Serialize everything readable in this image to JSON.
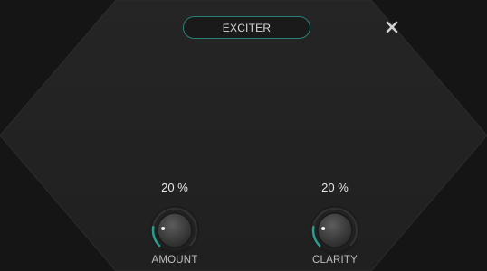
{
  "plugin": {
    "title": "EXCITER",
    "close_icon": "close-icon",
    "accent_color": "#2a9d8f"
  },
  "knobs": [
    {
      "label": "AMOUNT",
      "value_text": "20 %",
      "level": 0.2
    },
    {
      "label": "CLARITY",
      "value_text": "20 %",
      "level": 0.2
    }
  ]
}
